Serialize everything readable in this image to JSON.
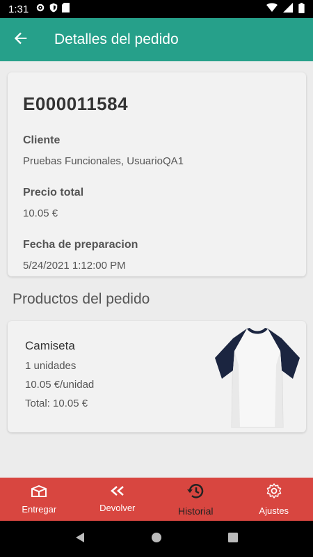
{
  "status_bar": {
    "time": "1:31"
  },
  "app_bar": {
    "title": "Detalles del pedido"
  },
  "order": {
    "id": "E000011584",
    "customer_label": "Cliente",
    "customer_value": "Pruebas Funcionales, UsuarioQA1",
    "total_label": "Precio total",
    "total_value": "10.05 €",
    "prep_label": "Fecha de preparacion",
    "prep_value": "5/24/2021 1:12:00 PM"
  },
  "products_section": {
    "title": "Productos del pedido"
  },
  "products": [
    {
      "name": "Camiseta",
      "units": "1 unidades",
      "unit_price": "10.05 €/unidad",
      "total": "Total: 10.05 €",
      "image_icon": "tshirt-image"
    }
  ],
  "bottom_nav": {
    "items": [
      {
        "label": "Entregar",
        "icon": "delivery-box-icon"
      },
      {
        "label": "Devolver",
        "icon": "double-chevron-left-icon"
      },
      {
        "label": "Historial",
        "icon": "history-icon"
      },
      {
        "label": "Ajustes",
        "icon": "gear-icon"
      }
    ]
  },
  "colors": {
    "app_bar": "#26a08a",
    "bottom_nav": "#d84640",
    "background": "#ececec"
  }
}
